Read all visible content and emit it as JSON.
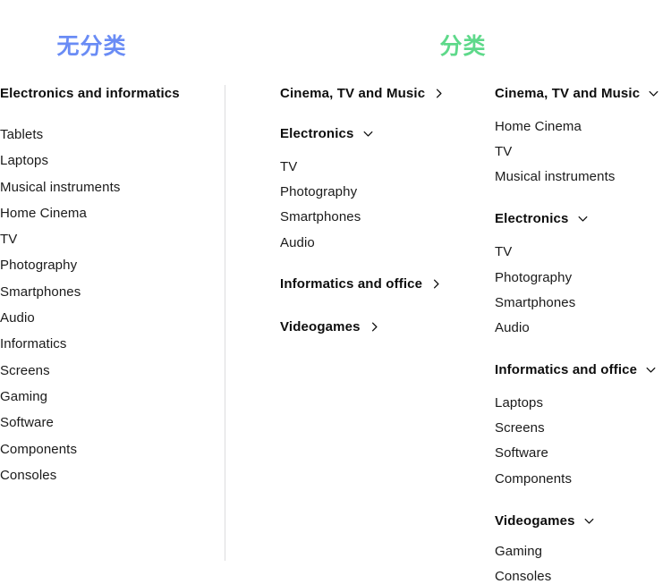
{
  "headers": {
    "uncategorized": {
      "label": "无分类",
      "color": "#6a8cf5"
    },
    "categorized": {
      "label": "分类",
      "color": "#5ed98a"
    }
  },
  "icons": {
    "chevron_right": "chevron-right-icon",
    "chevron_down": "chevron-down-icon"
  },
  "flat_column": {
    "heading": "Electronics and informatics",
    "items": [
      "Tablets",
      "Laptops",
      "Musical instruments",
      "Home Cinema",
      "TV",
      "Photography",
      "Smartphones",
      "Audio",
      "Informatics",
      "Screens",
      "Gaming",
      "Software",
      "Components",
      "Consoles"
    ]
  },
  "middle_column": {
    "groups": [
      {
        "label": "Cinema, TV and Music",
        "state": "collapsed",
        "chevron": "chevron-right-icon",
        "items": []
      },
      {
        "label": "Electronics",
        "state": "expanded",
        "chevron": "chevron-down-icon",
        "items": [
          "TV",
          "Photography",
          "Smartphones",
          "Audio"
        ]
      },
      {
        "label": "Informatics and office",
        "state": "collapsed",
        "chevron": "chevron-right-icon",
        "items": []
      },
      {
        "label": "Videogames",
        "state": "collapsed",
        "chevron": "chevron-right-icon",
        "items": []
      }
    ]
  },
  "right_column": {
    "groups": [
      {
        "label": "Cinema, TV and Music",
        "state": "expanded",
        "chevron": "chevron-down-icon",
        "items": [
          "Home Cinema",
          "TV",
          "Musical instruments"
        ]
      },
      {
        "label": "Electronics",
        "state": "expanded",
        "chevron": "chevron-down-icon",
        "items": [
          "TV",
          "Photography",
          "Smartphones",
          "Audio"
        ]
      },
      {
        "label": "Informatics and office",
        "state": "expanded",
        "chevron": "chevron-down-icon",
        "items": [
          "Laptops",
          "Screens",
          "Software",
          "Components"
        ]
      },
      {
        "label": "Videogames",
        "state": "expanded",
        "chevron": "chevron-down-icon",
        "items": [
          "Gaming",
          "Consoles"
        ]
      }
    ]
  }
}
